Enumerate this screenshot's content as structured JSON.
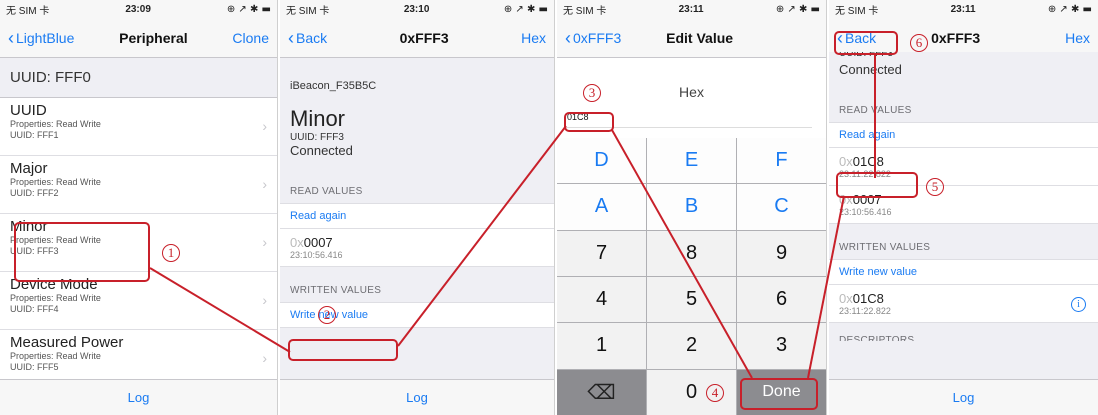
{
  "status": [
    {
      "carrier": "无 SIM 卡",
      "time": "23:09",
      "icons": "⊕ ↗ ✱ ▬"
    },
    {
      "carrier": "无 SIM 卡",
      "time": "23:10",
      "icons": "⊕ ↗ ✱ ▬"
    },
    {
      "carrier": "无 SIM 卡",
      "time": "23:11",
      "icons": "⊕ ↗ ✱ ▬"
    },
    {
      "carrier": "无 SIM 卡",
      "time": "23:11",
      "icons": "⊕ ↗ ✱ ▬"
    }
  ],
  "p1": {
    "back": "LightBlue",
    "title": "Peripheral",
    "right": "Clone",
    "service": "UUID: FFF0",
    "rows": [
      {
        "name": "UUID",
        "props": "Properties: Read Write",
        "uuid": "UUID: FFF1"
      },
      {
        "name": "Major",
        "props": "Properties: Read Write",
        "uuid": "UUID: FFF2"
      },
      {
        "name": "Minor",
        "props": "Properties: Read Write",
        "uuid": "UUID: FFF3"
      },
      {
        "name": "Device Mode",
        "props": "Properties: Read Write",
        "uuid": "UUID: FFF4"
      },
      {
        "name": "Measured Power",
        "props": "Properties: Read Write",
        "uuid": "UUID: FFF5"
      }
    ],
    "tab": "Log"
  },
  "p2": {
    "back": "Back",
    "title": "0xFFF3",
    "right": "Hex",
    "device": "iBeacon_F35B5C",
    "char": "Minor",
    "uuid": "UUID: FFF3",
    "state": "Connected",
    "read_header": "READ VALUES",
    "read_again": "Read again",
    "read_prefix": "0x",
    "read_value": "0007",
    "read_time": "23:10:56.416",
    "written_header": "WRITTEN VALUES",
    "write_new": "Write new value",
    "tab": "Log"
  },
  "p3": {
    "back": "0xFFF3",
    "title": "Edit Value",
    "mode": "Hex",
    "input": "01C8",
    "keys": [
      "D",
      "E",
      "F",
      "A",
      "B",
      "C",
      "7",
      "8",
      "9",
      "4",
      "5",
      "6",
      "1",
      "2",
      "3",
      "⌫",
      "0",
      "Done"
    ]
  },
  "p4": {
    "back": "Back",
    "title": "0xFFF3",
    "right": "Hex",
    "uuid_partial": "UUID: FFF3",
    "state": "Connected",
    "read_header": "READ VALUES",
    "read_again": "Read again",
    "r1_prefix": "0x",
    "r1_value": "01C8",
    "r1_time": "23:11:22.822",
    "r2_prefix": "0x",
    "r2_value": "0007",
    "r2_time": "23:10:56.416",
    "written_header": "WRITTEN VALUES",
    "write_new": "Write new value",
    "w1_prefix": "0x",
    "w1_value": "01C8",
    "w1_time": "23:11:22.822",
    "desc_header": "DESCRIPTORS",
    "tab": "Log"
  },
  "annotations": [
    "1",
    "2",
    "3",
    "4",
    "5",
    "6"
  ]
}
